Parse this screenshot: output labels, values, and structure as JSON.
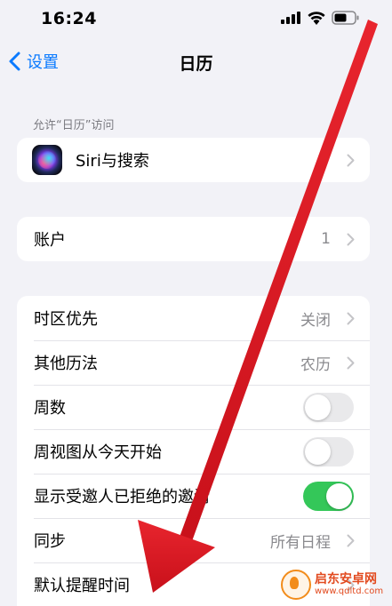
{
  "status_bar": {
    "time": "16:24"
  },
  "nav": {
    "back_label": "设置",
    "title": "日历"
  },
  "sections": {
    "access_header": "允许“日历”访问",
    "siri": {
      "label": "Siri与搜索"
    },
    "accounts": {
      "label": "账户",
      "value": "1"
    },
    "settings": [
      {
        "label": "时区优先",
        "value": "关闭",
        "kind": "chevron"
      },
      {
        "label": "其他历法",
        "value": "农历",
        "kind": "chevron"
      },
      {
        "label": "周数",
        "kind": "toggle",
        "on": false
      },
      {
        "label": "周视图从今天开始",
        "kind": "toggle",
        "on": false
      },
      {
        "label": "显示受邀人已拒绝的邀请",
        "kind": "toggle",
        "on": true
      },
      {
        "label": "同步",
        "value": "所有日程",
        "kind": "chevron"
      },
      {
        "label": "默认提醒时间",
        "kind": "chevron"
      }
    ]
  },
  "watermark": {
    "title": "启东安卓网",
    "url": "www.qdltd.com"
  },
  "colors": {
    "accent": "#0a7aff",
    "toggle_on": "#34c759",
    "arrow": "#e3202a",
    "background": "#f2f2f7"
  }
}
